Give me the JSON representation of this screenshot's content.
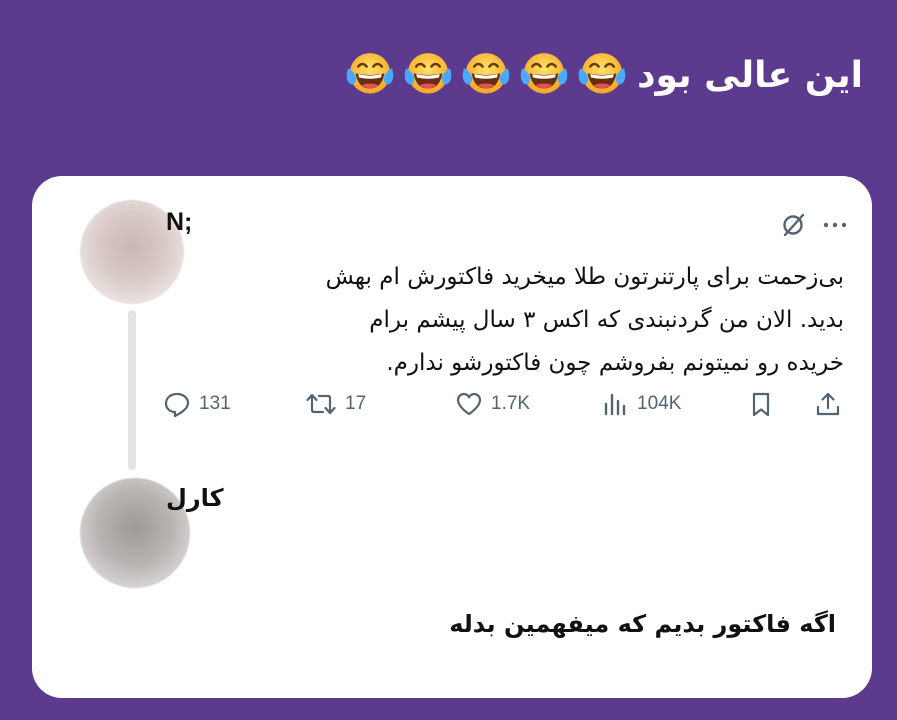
{
  "caption": {
    "text": "این عالی بود",
    "emoji_icon": "face-with-tears-of-joy-icon",
    "emoji_count": 5
  },
  "tweet": {
    "author": "N;",
    "lines": [
      "بی‌زحمت برای پارتنرتون طلا میخرید فاکتورش ام بهش",
      "بدید. الان من گردنبندی که اکس ۳ سال پیشم برام",
      "خریده رو نمیتونم بفروشم چون فاکتورشو ندارم."
    ],
    "stats": {
      "replies": "131",
      "retweets": "17",
      "likes": "1.7K",
      "views": "104K"
    }
  },
  "reply": {
    "author": "کارل",
    "text": "اگه فاکتور بدیم که میفهمین بدله"
  },
  "colors": {
    "background": "#5c3a8e",
    "card": "#ffffff",
    "icon_gray": "#536471"
  }
}
